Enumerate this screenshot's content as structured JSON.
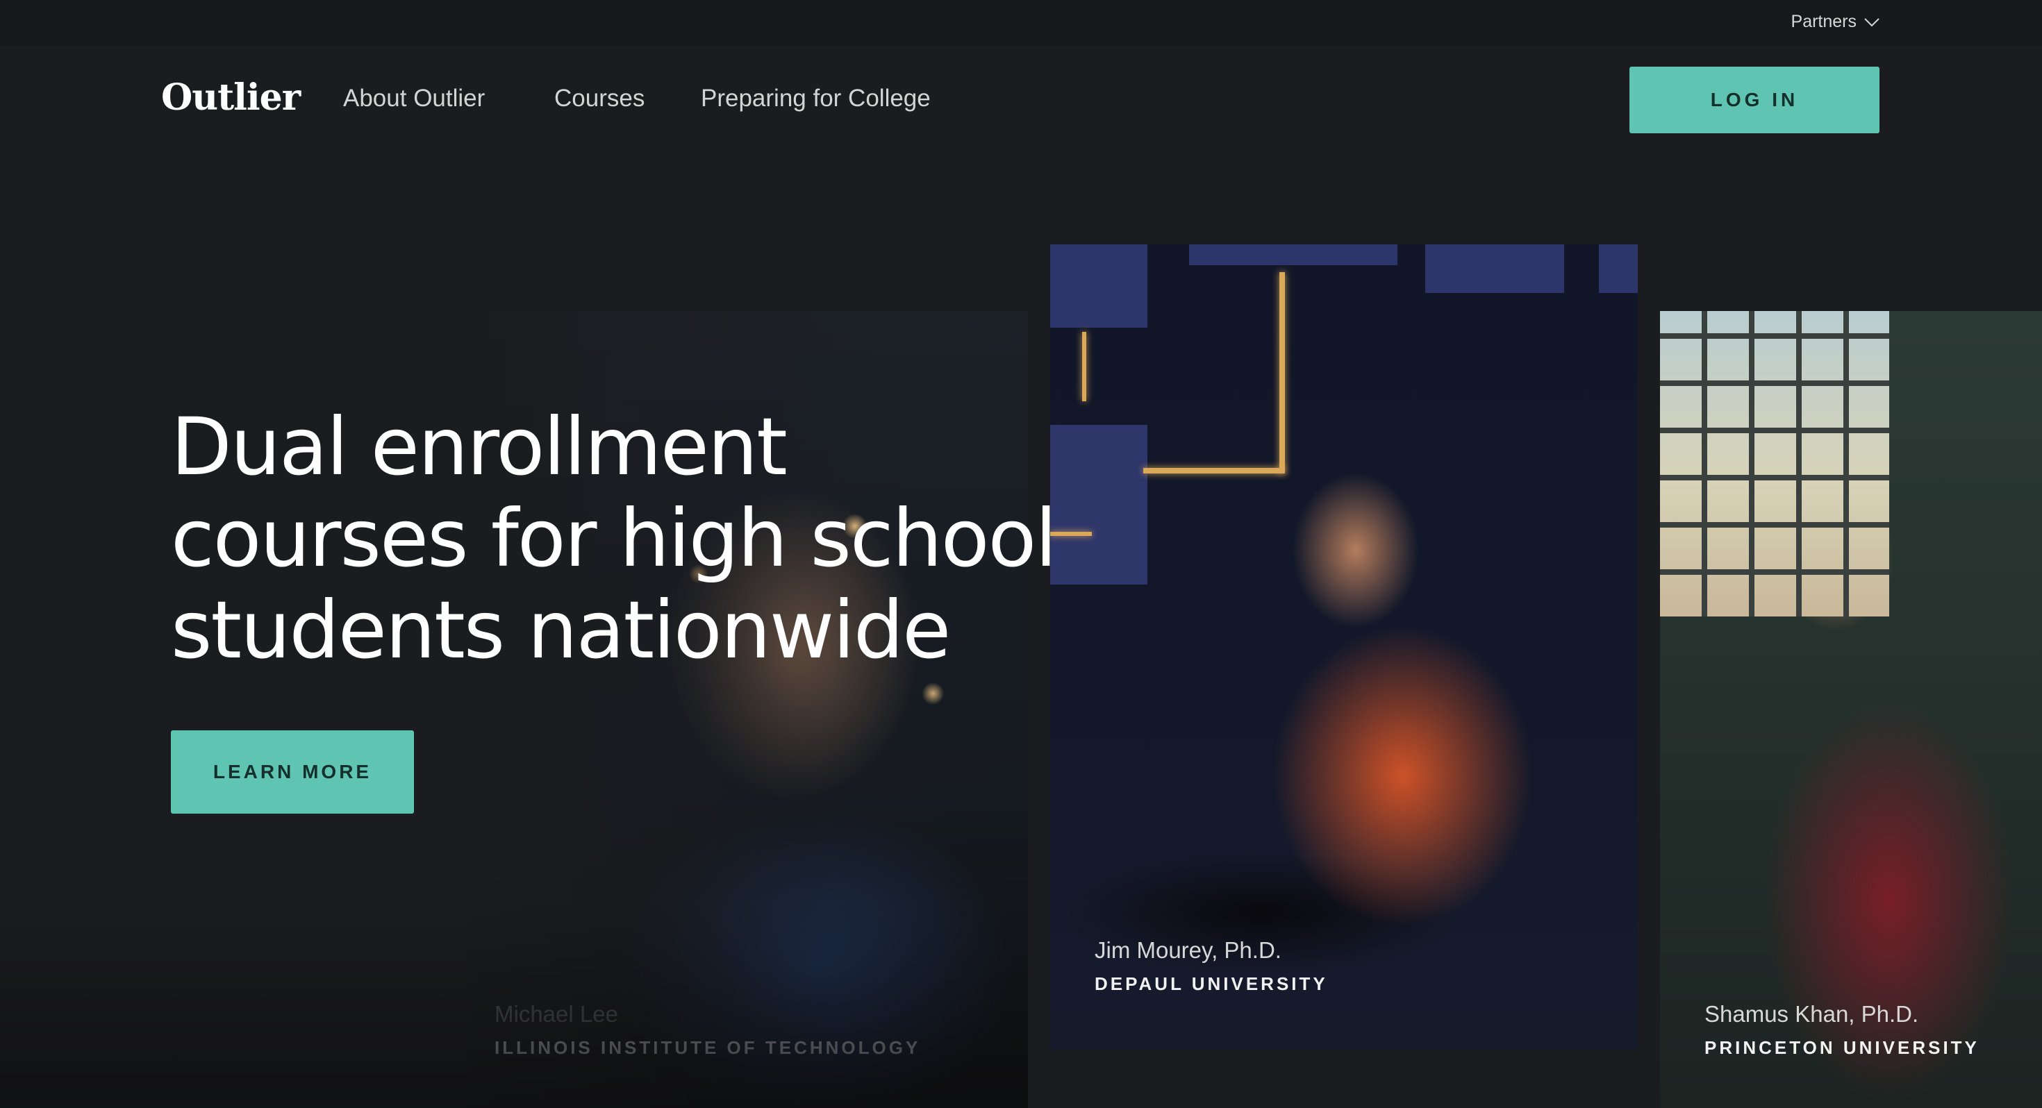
{
  "topbar": {
    "partners_label": "Partners"
  },
  "nav": {
    "logo_text": "Outlier",
    "links": [
      {
        "label": "About Outlier"
      },
      {
        "label": "Courses"
      },
      {
        "label": "Preparing for College"
      }
    ],
    "login_label": "LOG IN"
  },
  "hero": {
    "title_line_1": "Dual enrollment",
    "title_line_2": "courses for high school",
    "title_line_3": "students nationwide",
    "cta_label": "LEARN MORE"
  },
  "instructors": [
    {
      "name": "Michael Lee",
      "school": "ILLINOIS INSTITUTE OF TECHNOLOGY"
    },
    {
      "name": "Jim Mourey, Ph.D.",
      "school": "DEPAUL UNIVERSITY"
    },
    {
      "name": "Shamus Khan, Ph.D.",
      "school": "PRINCETON UNIVERSITY"
    }
  ],
  "colors": {
    "background": "#1b1c1f",
    "accent": "#5fc4b2",
    "accent_text": "#15302c"
  }
}
